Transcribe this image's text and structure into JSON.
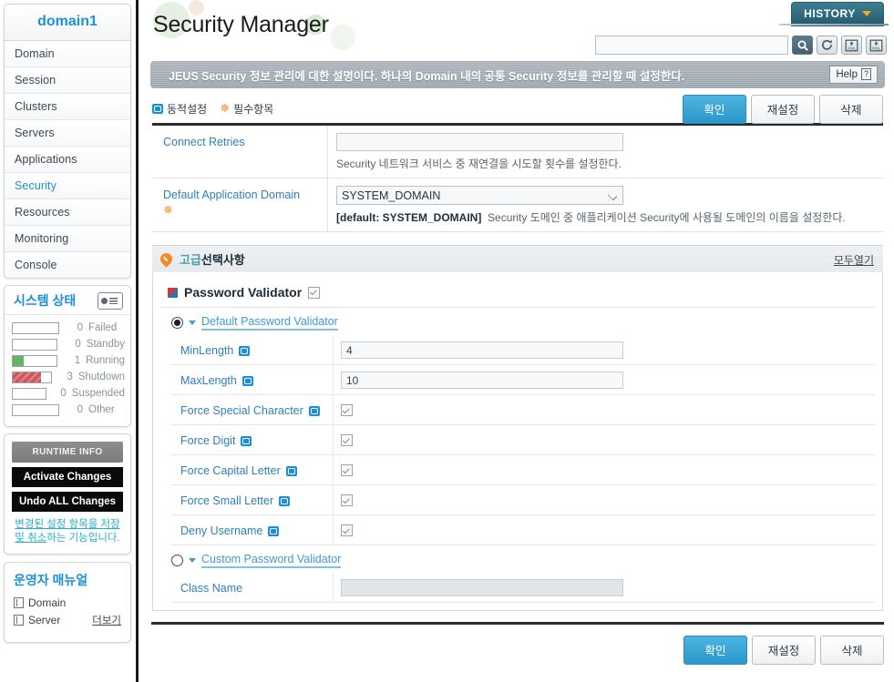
{
  "sidebar": {
    "domain_title": "domain1",
    "nav_items": [
      {
        "label": "Domain",
        "active": false
      },
      {
        "label": "Session",
        "active": false
      },
      {
        "label": "Clusters",
        "active": false
      },
      {
        "label": "Servers",
        "active": false
      },
      {
        "label": "Applications",
        "active": false
      },
      {
        "label": "Security",
        "active": true
      },
      {
        "label": "Resources",
        "active": false
      },
      {
        "label": "Monitoring",
        "active": false
      },
      {
        "label": "Console",
        "active": false
      }
    ],
    "status": {
      "title": "시스템 상태",
      "rows": [
        {
          "count": "0",
          "label": "Failed",
          "percent": 0,
          "color": "none"
        },
        {
          "count": "0",
          "label": "Standby",
          "percent": 0,
          "color": "none"
        },
        {
          "count": "1",
          "label": "Running",
          "percent": 25,
          "color": "green"
        },
        {
          "count": "3",
          "label": "Shutdown",
          "percent": 75,
          "color": "red"
        },
        {
          "count": "0",
          "label": "Suspended",
          "percent": 0,
          "color": "none"
        },
        {
          "count": "0",
          "label": "Other",
          "percent": 0,
          "color": "none"
        }
      ]
    },
    "actions": {
      "runtime_info": "RUNTIME INFO",
      "activate_changes": "Activate Changes",
      "undo_all_changes": "Undo ALL Changes",
      "hint_underlined": "변경된 설정 항목을 저장 및 취소",
      "hint_rest": "하는 기능입니다."
    },
    "manual": {
      "title": "운영자 매뉴얼",
      "items": [
        "Domain",
        "Server"
      ],
      "more_label": "더보기"
    }
  },
  "header": {
    "title": "Security Manager",
    "history_label": "HISTORY",
    "search_value": "",
    "search_placeholder": "",
    "icons": [
      "search-icon",
      "refresh-icon",
      "xml-import-icon",
      "xml-export-icon"
    ]
  },
  "description": {
    "text": "JEUS Security 정보 관리에 대한 설명이다. 하나의 Domain 내의 공통 Security 정보를 관리할 때 설정한다.",
    "help_label": "Help"
  },
  "legend": {
    "dynamic": "동적설정",
    "required": "필수항목"
  },
  "toolbar": {
    "confirm": "확인",
    "reset": "재설정",
    "delete": "삭제"
  },
  "form": {
    "rows": [
      {
        "label": "Connect Retries",
        "required": false,
        "type": "text",
        "value": "",
        "note": "Security 네트워크 서비스 중 재연결을 시도할 횟수를 설정한다.",
        "note_default": ""
      },
      {
        "label": "Default Application Domain",
        "required": true,
        "type": "select",
        "value": "SYSTEM_DOMAIN",
        "note": "Security 도메인 중 애플리케이션 Security에 사용될 도메인의 이름을 설정한다.",
        "note_default": "[default: SYSTEM_DOMAIN]"
      }
    ]
  },
  "advanced": {
    "badge": "고급",
    "title": "선택사항",
    "expand_all": "모두열기",
    "password_validator": {
      "title": "Password Validator",
      "checked": true,
      "default_option": {
        "label": "Default Password Validator",
        "selected": true,
        "fields": [
          {
            "label": "MinLength",
            "dynamic": true,
            "type": "text",
            "value": "4"
          },
          {
            "label": "MaxLength",
            "dynamic": true,
            "type": "text",
            "value": "10"
          },
          {
            "label": "Force Special Character",
            "dynamic": true,
            "type": "checkbox",
            "checked": true
          },
          {
            "label": "Force Digit",
            "dynamic": true,
            "type": "checkbox",
            "checked": true
          },
          {
            "label": "Force Capital Letter",
            "dynamic": true,
            "type": "checkbox",
            "checked": true
          },
          {
            "label": "Force Small Letter",
            "dynamic": true,
            "type": "checkbox",
            "checked": true
          },
          {
            "label": "Deny Username",
            "dynamic": true,
            "type": "checkbox",
            "checked": true
          }
        ]
      },
      "custom_option": {
        "label": "Custom Password Validator",
        "selected": false,
        "fields": [
          {
            "label": "Class Name",
            "dynamic": false,
            "type": "text",
            "value": "",
            "disabled": true
          }
        ]
      }
    }
  },
  "footer": {
    "confirm": "확인",
    "reset": "재설정",
    "delete": "삭제"
  }
}
